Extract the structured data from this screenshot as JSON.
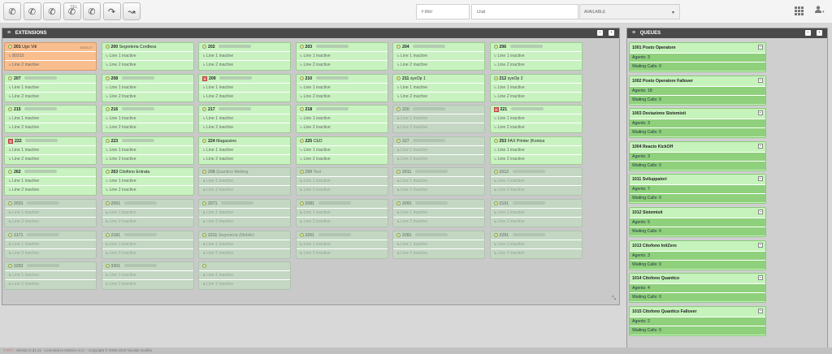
{
  "toolbar": {
    "buttons": [
      {
        "icon": "phone-icon",
        "badge": ""
      },
      {
        "icon": "phone-transfer-icon",
        "badge": ""
      },
      {
        "icon": "phone-conference-icon",
        "badge": ""
      },
      {
        "icon": "phone-hold-icon",
        "badge": "TEL"
      },
      {
        "icon": "phone-park-icon",
        "badge": ""
      },
      {
        "icon": "phone-redirect-icon",
        "badge": ""
      },
      {
        "icon": "phone-forward-icon",
        "badge": ""
      }
    ],
    "filter_placeholder": "Filter",
    "dial_placeholder": "Dial",
    "status_value": "AVAILABLE"
  },
  "extensions": {
    "title": "EXTENSIONS",
    "cards": [
      {
        "num": "201",
        "name": "Ugo Viti",
        "state": "busy",
        "line1": "80315",
        "line2": "Line 2 inactive",
        "timer": "00:03:27",
        "icon": "dot"
      },
      {
        "num": "200",
        "name": "Segreteria Cordless",
        "state": "online",
        "line1": "Line 1 inactive",
        "line2": "Line 2 inactive",
        "icon": "dot"
      },
      {
        "num": "202",
        "name": "",
        "state": "online",
        "line1": "Line 1 inactive",
        "line2": "Line 2 inactive",
        "icon": "dot"
      },
      {
        "num": "203",
        "name": "",
        "state": "online",
        "line1": "Line 1 inactive",
        "line2": "Line 2 inactive",
        "icon": "dot"
      },
      {
        "num": "204",
        "name": "",
        "state": "online",
        "line1": "Line 1 inactive",
        "line2": "Line 2 inactive",
        "icon": "dot"
      },
      {
        "num": "206",
        "name": "",
        "state": "online",
        "line1": "Line 1 inactive",
        "line2": "Line 2 inactive",
        "icon": "dot"
      },
      {
        "num": "207",
        "name": "",
        "state": "online",
        "line1": "Line 1 inactive",
        "line2": "Line 2 inactive",
        "icon": "dot"
      },
      {
        "num": "208",
        "name": "",
        "state": "online",
        "line1": "Line 1 inactive",
        "line2": "Line 2 inactive",
        "icon": "dot"
      },
      {
        "num": "209",
        "name": "",
        "state": "online",
        "line1": "Line 1 inactive",
        "line2": "Line 2 inactive",
        "icon": "red"
      },
      {
        "num": "210",
        "name": "",
        "state": "online",
        "line1": "Line 1 inactive",
        "line2": "Line 2 inactive",
        "icon": "dot"
      },
      {
        "num": "211",
        "name": "sysOp 1",
        "state": "online",
        "line1": "Line 1 inactive",
        "line2": "Line 2 inactive",
        "icon": "dot"
      },
      {
        "num": "212",
        "name": "sysOp 2",
        "state": "online",
        "line1": "Line 1 inactive",
        "line2": "Line 2 inactive",
        "icon": "dot"
      },
      {
        "num": "215",
        "name": "",
        "state": "online",
        "line1": "Line 1 inactive",
        "line2": "Line 2 inactive",
        "icon": "dot"
      },
      {
        "num": "216",
        "name": "",
        "state": "online",
        "line1": "Line 1 inactive",
        "line2": "Line 2 inactive",
        "icon": "dot"
      },
      {
        "num": "217",
        "name": "",
        "state": "online",
        "line1": "Line 1 inactive",
        "line2": "Line 2 inactive",
        "icon": "dot"
      },
      {
        "num": "218",
        "name": "",
        "state": "online",
        "line1": "Line 1 inactive",
        "line2": "Line 2 inactive",
        "icon": "dot"
      },
      {
        "num": "220",
        "name": "",
        "state": "offline",
        "line1": "Line 1 inactive",
        "line2": "Line 2 inactive",
        "icon": "dot"
      },
      {
        "num": "221",
        "name": "",
        "state": "online",
        "line1": "Line 1 inactive",
        "line2": "Line 2 inactive",
        "icon": "red"
      },
      {
        "num": "222",
        "name": "",
        "state": "online",
        "line1": "Line 1 inactive",
        "line2": "Line 2 inactive",
        "icon": "red"
      },
      {
        "num": "223",
        "name": "",
        "state": "online",
        "line1": "Line 1 inactive",
        "line2": "Line 2 inactive",
        "icon": "dot"
      },
      {
        "num": "224",
        "name": "Magazzino",
        "state": "online",
        "line1": "Line 1 inactive",
        "line2": "Line 2 inactive",
        "icon": "dot"
      },
      {
        "num": "225",
        "name": "CED",
        "state": "online",
        "line1": "Line 1 inactive",
        "line2": "Line 2 inactive",
        "icon": "dot"
      },
      {
        "num": "227",
        "name": "",
        "state": "offline",
        "line1": "Line 1 inactive",
        "line2": "Line 2 inactive",
        "icon": "dot"
      },
      {
        "num": "253",
        "name": "FAX Printer (Konica",
        "state": "online",
        "line1": "Line 1 inactive",
        "line2": "Line 2 inactive",
        "icon": "dot"
      },
      {
        "num": "262",
        "name": "",
        "state": "online",
        "line1": "Line 1 inactive",
        "line2": "Line 2 inactive",
        "icon": "dot"
      },
      {
        "num": "263",
        "name": "Citofono Entrata",
        "state": "online",
        "line1": "Line 1 inactive",
        "line2": "Line 2 inactive",
        "icon": "dot"
      },
      {
        "num": "298",
        "name": "Quantico Metting",
        "state": "offline",
        "line1": "Line 1 inactive",
        "line2": "Line 2 inactive",
        "icon": "dot"
      },
      {
        "num": "299",
        "name": "Test",
        "state": "offline",
        "line1": "Line 1 inactive",
        "line2": "Line 2 inactive",
        "icon": "dot"
      },
      {
        "num": "2011",
        "name": "",
        "state": "offline",
        "line1": "Line 1 inactive",
        "line2": "Line 2 inactive",
        "icon": "dot"
      },
      {
        "num": "2012",
        "name": "",
        "state": "offline",
        "line1": "Line 1 inactive",
        "line2": "Line 2 inactive",
        "icon": "dot"
      },
      {
        "num": "2031",
        "name": "",
        "state": "offline",
        "line1": "Line 1 inactive",
        "line2": "Line 2 inactive",
        "icon": "dot"
      },
      {
        "num": "2061",
        "name": "",
        "state": "offline",
        "line1": "Line 1 inactive",
        "line2": "Line 2 inactive",
        "icon": "dot"
      },
      {
        "num": "2071",
        "name": "",
        "state": "offline",
        "line1": "Line 1 inactive",
        "line2": "Line 2 inactive",
        "icon": "dot"
      },
      {
        "num": "2081",
        "name": "",
        "state": "offline",
        "line1": "Line 1 inactive",
        "line2": "Line 2 inactive",
        "icon": "dot"
      },
      {
        "num": "2091",
        "name": "",
        "state": "offline",
        "line1": "Line 1 inactive",
        "line2": "Line 2 inactive",
        "icon": "dot"
      },
      {
        "num": "2101",
        "name": "",
        "state": "offline",
        "line1": "Line 1 inactive",
        "line2": "Line 2 inactive",
        "icon": "dot"
      },
      {
        "num": "2171",
        "name": "",
        "state": "offline",
        "line1": "Line 1 inactive",
        "line2": "Line 2 inactive",
        "icon": "dot"
      },
      {
        "num": "2181",
        "name": "",
        "state": "offline",
        "line1": "Line 1 inactive",
        "line2": "Line 2 inactive",
        "icon": "dot"
      },
      {
        "num": "2211",
        "name": "Segreteria (Mobile)",
        "state": "offline",
        "line1": "Line 1 inactive",
        "line2": "Line 2 inactive",
        "icon": "dot"
      },
      {
        "num": "2261",
        "name": "",
        "state": "offline",
        "line1": "Line 1 inactive",
        "line2": "Line 2 inactive",
        "icon": "dot"
      },
      {
        "num": "2281",
        "name": "",
        "state": "offline",
        "line1": "Line 1 inactive",
        "line2": "Line 2 inactive",
        "icon": "dot"
      },
      {
        "num": "2291",
        "name": "",
        "state": "offline",
        "line1": "Line 1 inactive",
        "line2": "Line 2 inactive",
        "icon": "dot"
      },
      {
        "num": "2292",
        "name": "",
        "state": "offline",
        "line1": "Line 1 inactive",
        "line2": "Line 2 inactive",
        "icon": "dot"
      },
      {
        "num": "3301",
        "name": "",
        "state": "offline",
        "line1": "Line 1 inactive",
        "line2": "Line 2 inactive",
        "icon": "dot"
      },
      {
        "num": "",
        "name": "",
        "state": "offline",
        "line1": "Line 1 inactive",
        "line2": "Line 2 inactive",
        "icon": "dot"
      }
    ]
  },
  "queues": {
    "title": "QUEUES",
    "items": [
      {
        "name": "1001 Posto Operatore",
        "agents": "Agents: 3",
        "waiting": "Waiting Calls: 0"
      },
      {
        "name": "1002 Posto Operatore Fallover",
        "agents": "Agents: 18",
        "waiting": "Waiting Calls: 0"
      },
      {
        "name": "1003 Deviazione Sistemisti",
        "agents": "Agents: 3",
        "waiting": "Waiting Calls: 0"
      },
      {
        "name": "1004 Reacto KickOff",
        "agents": "Agents: 3",
        "waiting": "Waiting Calls: 0"
      },
      {
        "name": "1011 Sviluppatori",
        "agents": "Agents: 7",
        "waiting": "Waiting Calls: 0"
      },
      {
        "name": "1012 Sistemisti",
        "agents": "Agents: 5",
        "waiting": "Waiting Calls: 0"
      },
      {
        "name": "1013 Citofono InitZero",
        "agents": "Agents: 3",
        "waiting": "Waiting Calls: 0"
      },
      {
        "name": "1014 Citofono Quantico",
        "agents": "Agents: 4",
        "waiting": "Waiting Calls: 0"
      },
      {
        "name": "1015 Citofono Quantico Fallover",
        "agents": "Agents: 2",
        "waiting": "Waiting Calls: 0"
      }
    ]
  },
  "footer": {
    "brand": "FOP2",
    "text": " - Version 2.31.21 - Licensed to InitZero S.r.l. - Copyright © 2009-2018 Nicolás Gudiño"
  },
  "colors": {
    "online": "#c8f3c1",
    "offline": "#c3d7c3",
    "busy": "#f8be8e",
    "panel_header": "#4a4a4a",
    "queue_bar": "#8fd07c"
  }
}
